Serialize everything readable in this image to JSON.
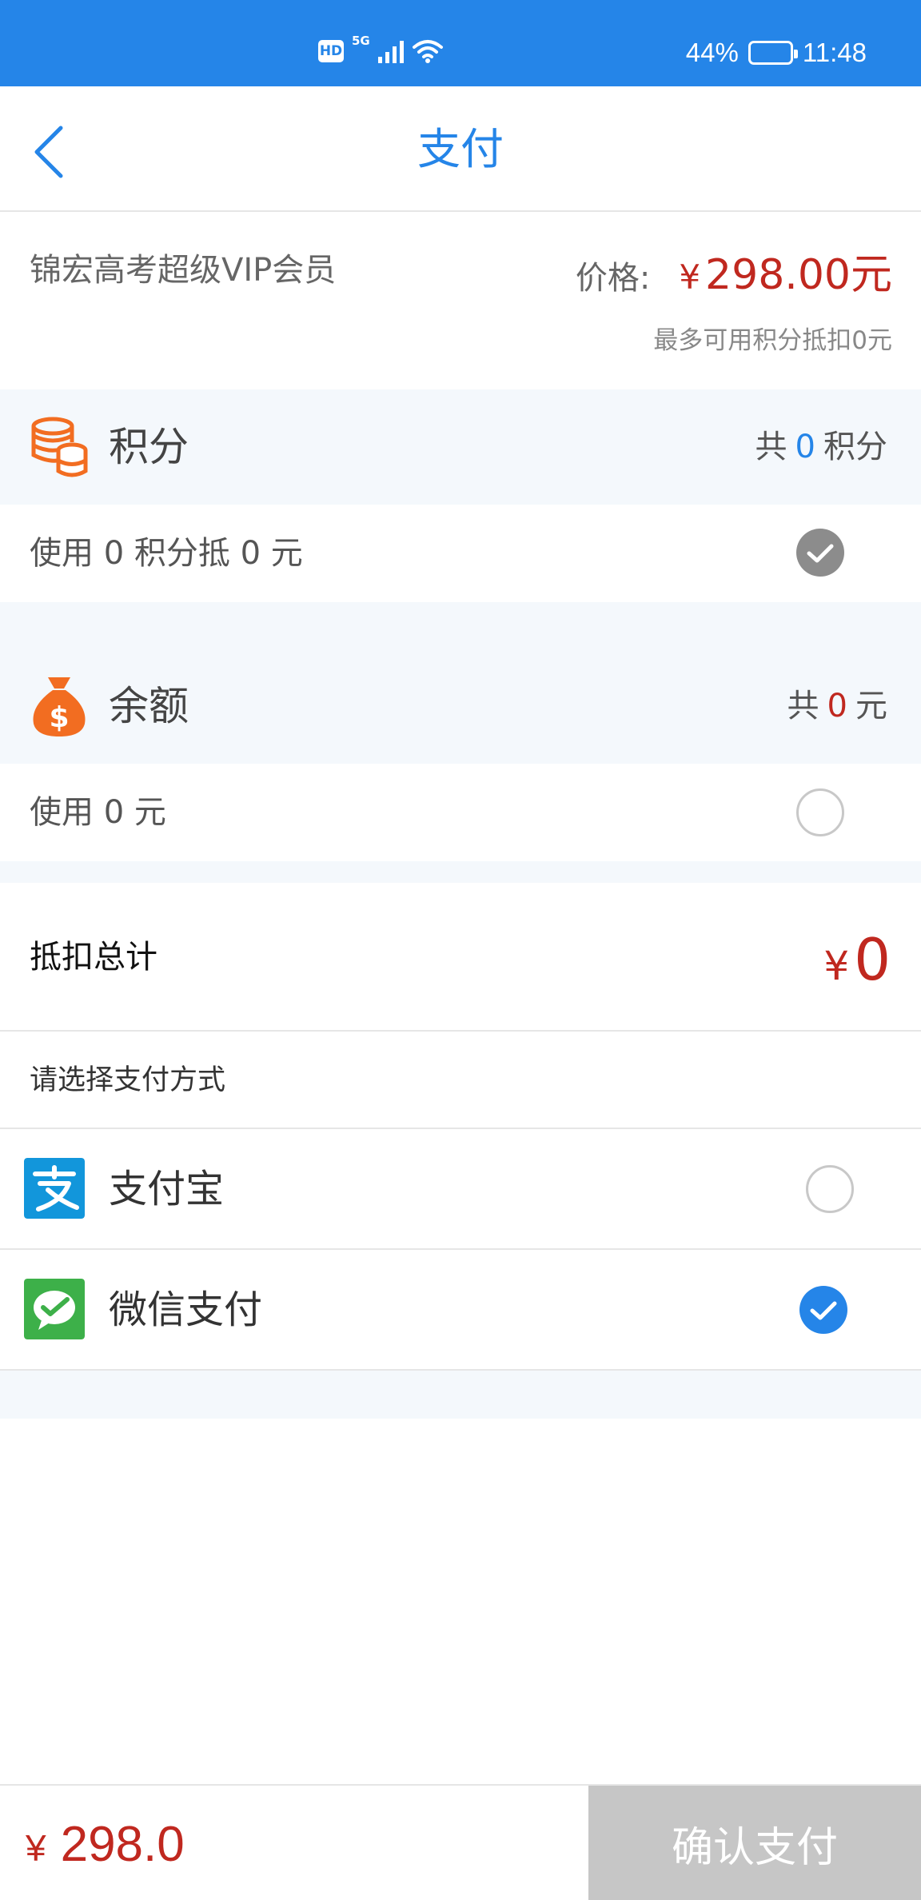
{
  "status_bar": {
    "hd": "HD",
    "network": "5G",
    "battery_percent": "44%",
    "battery_level": 0.44,
    "time": "11:48"
  },
  "nav": {
    "title": "支付"
  },
  "product": {
    "name": "锦宏高考超级VIP会员",
    "price_label": "价格:",
    "currency": "¥",
    "price": "298.00元",
    "points_note": "最多可用积分抵扣0元"
  },
  "points": {
    "label": "积分",
    "total_prefix": "共",
    "total_value": "0",
    "total_suffix": "积分",
    "use_text": "使用 0 积分抵 0 元",
    "checked": true
  },
  "balance": {
    "label": "余额",
    "total_prefix": "共",
    "total_value": "0",
    "total_suffix": "元",
    "use_text": "使用 0 元",
    "checked": false
  },
  "deduction": {
    "label": "抵扣总计",
    "currency": "¥",
    "value": "0"
  },
  "payment": {
    "title": "请选择支付方式",
    "methods": [
      {
        "label": "支付宝",
        "icon": "alipay-icon",
        "selected": false
      },
      {
        "label": "微信支付",
        "icon": "wechat-pay-icon",
        "selected": true
      }
    ]
  },
  "footer": {
    "currency": "¥",
    "total": "298.0",
    "confirm_label": "确认支付"
  },
  "colors": {
    "primary": "#2585e8",
    "price_red": "#c0281f",
    "section_bg": "#f4f8fc",
    "disabled_button": "#c6c6c6",
    "alipay": "#1296db",
    "wechat": "#3db049",
    "orange_icon": "#f26d21"
  }
}
